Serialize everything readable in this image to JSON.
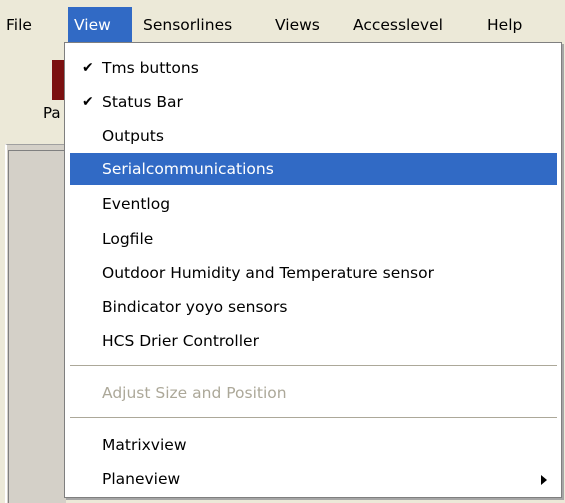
{
  "menubar": {
    "items": [
      {
        "label": "File"
      },
      {
        "label": "View"
      },
      {
        "label": "Sensorlines"
      },
      {
        "label": "Views"
      },
      {
        "label": "Accesslevel"
      },
      {
        "label": "Help"
      }
    ]
  },
  "background": {
    "toolbar_label": "Pa"
  },
  "view_menu": {
    "checkmark": "✔",
    "items": [
      {
        "label": "Tms buttons",
        "checked": true
      },
      {
        "label": "Status Bar",
        "checked": true
      },
      {
        "label": "Outputs"
      },
      {
        "label": "Serialcommunications",
        "highlighted": true
      },
      {
        "label": "Eventlog"
      },
      {
        "label": "Logfile"
      },
      {
        "label": "Outdoor Humidity and Temperature sensor"
      },
      {
        "label": "Bindicator yoyo sensors"
      },
      {
        "label": "HCS Drier Controller"
      },
      {
        "label": "Adjust Size and Position",
        "disabled": true
      },
      {
        "label": "Matrixview"
      },
      {
        "label": "Planeview",
        "submenu": true
      }
    ]
  },
  "colors": {
    "highlight": "#316ac5",
    "menubar_bg": "#ece9d8",
    "disabled_text": "#aca899"
  }
}
